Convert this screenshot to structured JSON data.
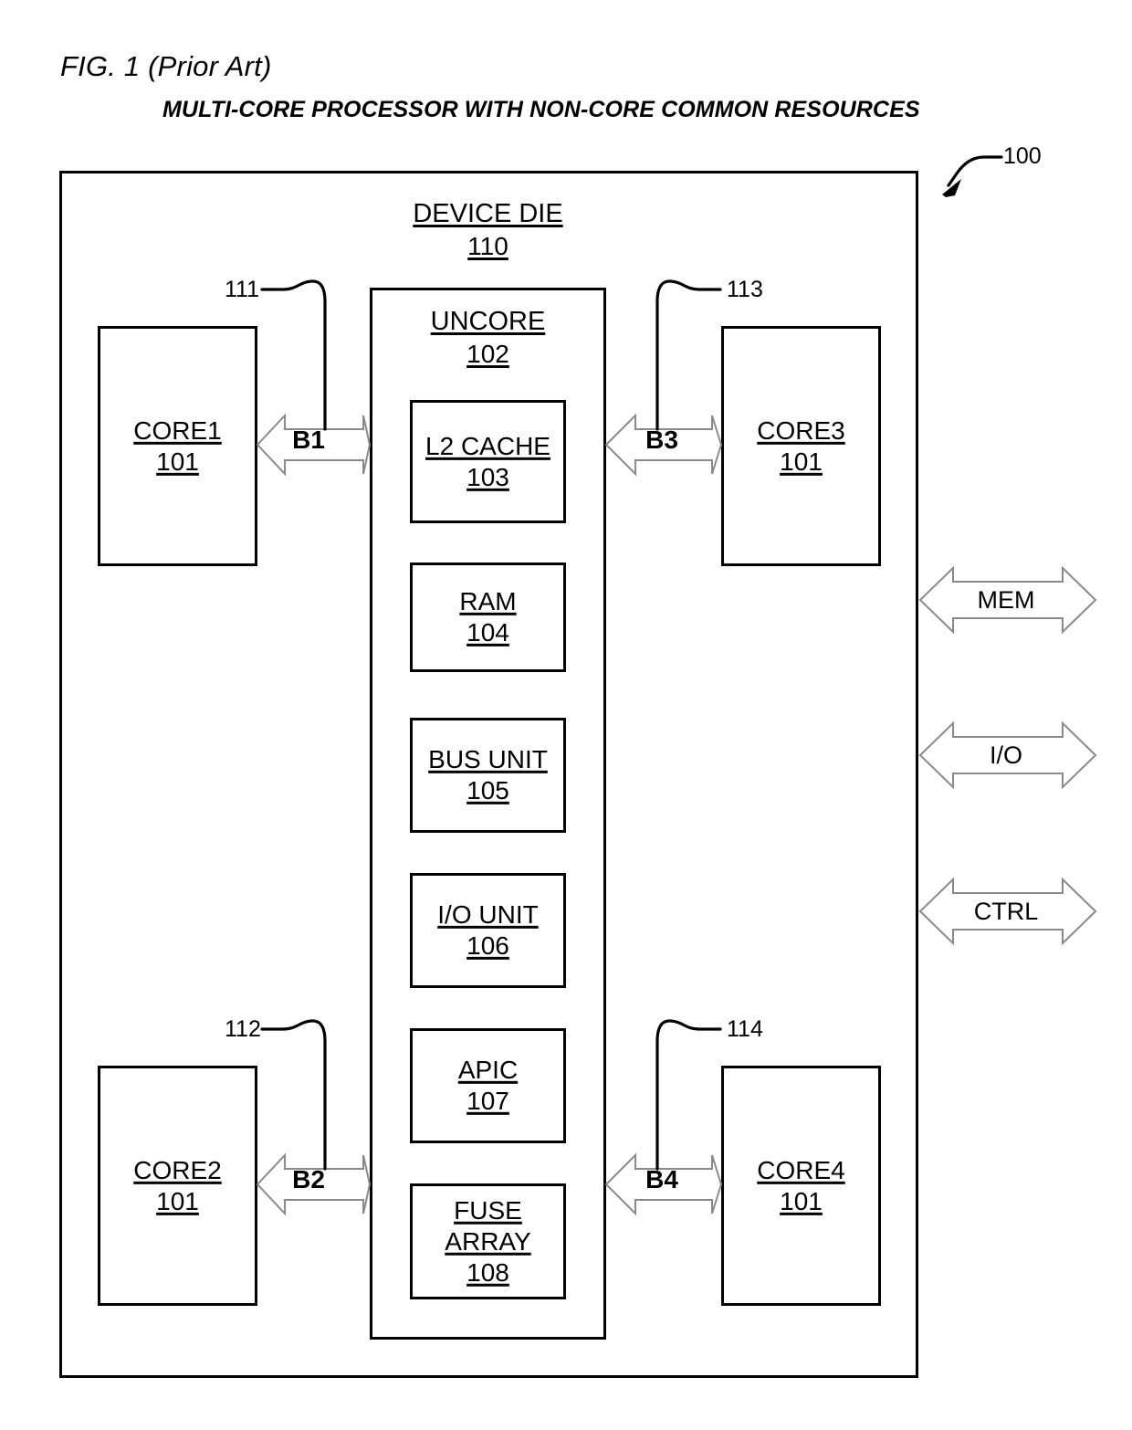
{
  "figure": {
    "title": "FIG. 1 (Prior Art)",
    "subtitle": "MULTI-CORE PROCESSOR WITH NON-CORE COMMON RESOURCES",
    "system_ref": "100"
  },
  "device_die": {
    "name": "DEVICE DIE",
    "ref": "110"
  },
  "uncore": {
    "name": "UNCORE",
    "ref": "102",
    "units": [
      {
        "name": "L2 CACHE",
        "ref": "103"
      },
      {
        "name": "RAM",
        "ref": "104"
      },
      {
        "name": "BUS UNIT",
        "ref": "105"
      },
      {
        "name": "I/O UNIT",
        "ref": "106"
      },
      {
        "name": "APIC",
        "ref": "107"
      },
      {
        "name": "FUSE ARRAY",
        "ref": "108"
      }
    ]
  },
  "cores": [
    {
      "name": "CORE1",
      "ref": "101"
    },
    {
      "name": "CORE2",
      "ref": "101"
    },
    {
      "name": "CORE3",
      "ref": "101"
    },
    {
      "name": "CORE4",
      "ref": "101"
    }
  ],
  "buses": [
    {
      "label": "B1",
      "ref": "111"
    },
    {
      "label": "B2",
      "ref": "112"
    },
    {
      "label": "B3",
      "ref": "113"
    },
    {
      "label": "B4",
      "ref": "114"
    }
  ],
  "external_ports": [
    {
      "label": "MEM"
    },
    {
      "label": "I/O"
    },
    {
      "label": "CTRL"
    }
  ],
  "colors": {
    "line": "#000000",
    "arrow_outline": "#808080",
    "background": "#ffffff"
  }
}
